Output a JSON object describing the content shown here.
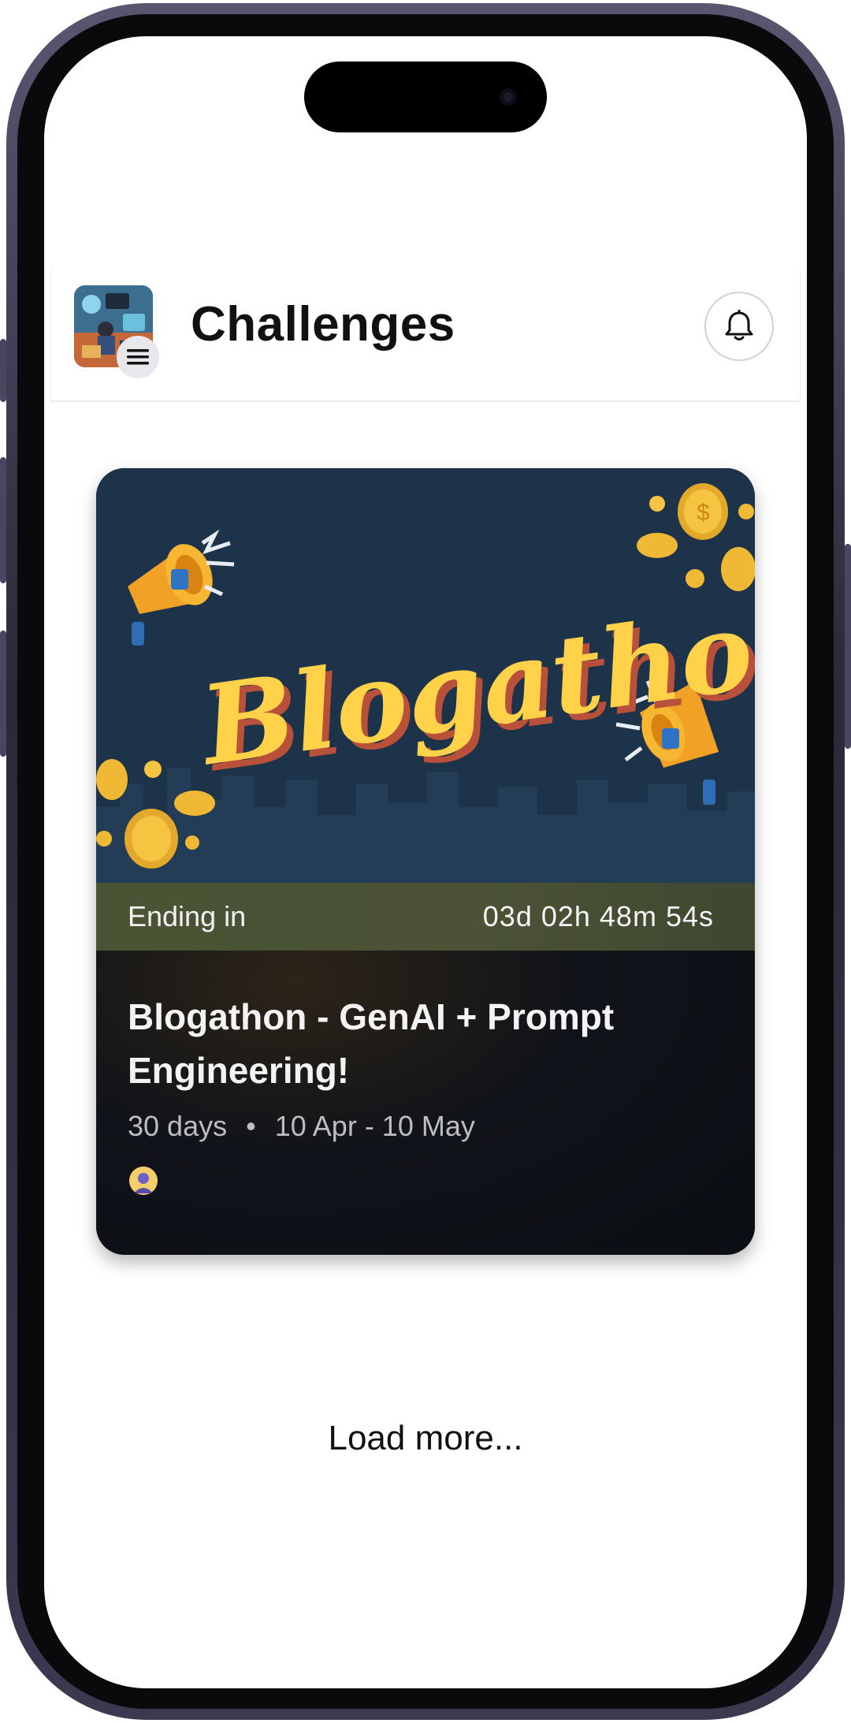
{
  "header": {
    "title": "Challenges"
  },
  "icons": {
    "menu": "menu-icon",
    "bell": "bell-icon"
  },
  "challenge_card": {
    "banner_text": "Blogathon",
    "ending_label": "Ending in",
    "countdown": "03d 02h 48m 54s",
    "title": "Blogathon - GenAI + Prompt Engineering!",
    "duration": "30 days",
    "separator": "•",
    "date_range": "10 Apr - 10 May"
  },
  "footer": {
    "load_more": "Load more..."
  },
  "colors": {
    "banner_bg": "#1d3349",
    "banner_text": "#ffd24a",
    "timer_bar": "#4a5334",
    "card_body": "#0c1016"
  }
}
